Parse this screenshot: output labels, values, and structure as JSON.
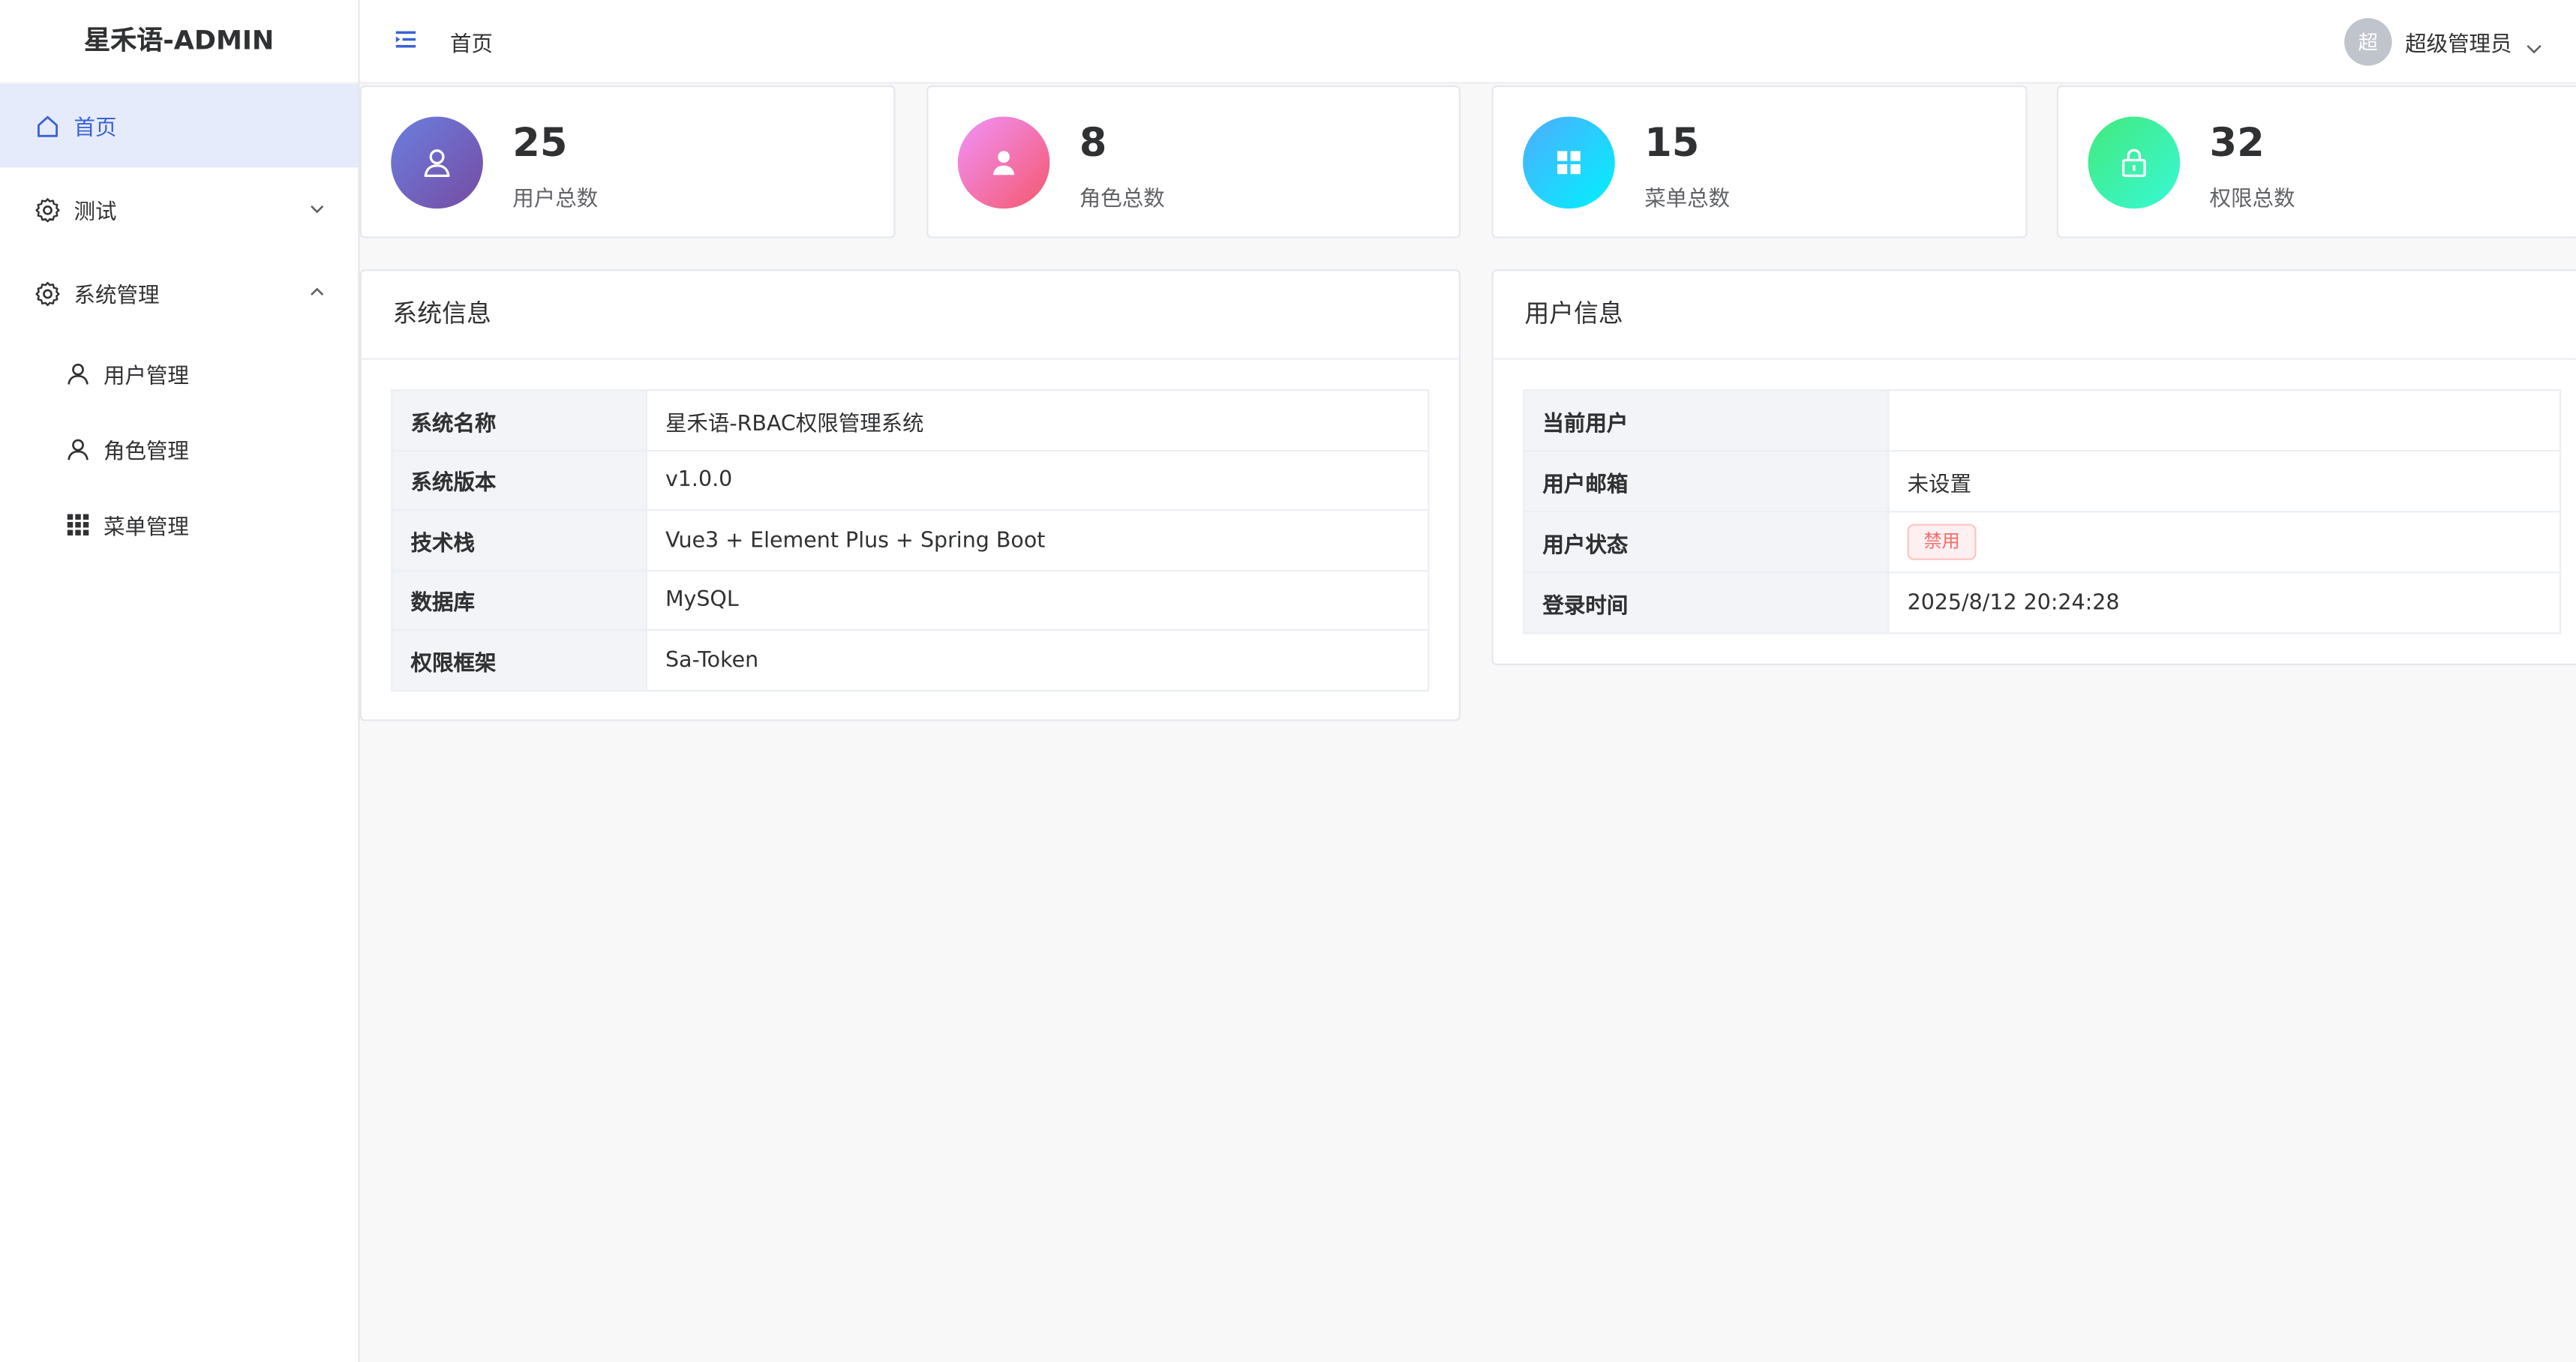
{
  "app": {
    "title": "星禾语-ADMIN"
  },
  "sidebar": {
    "home": {
      "label": "首页",
      "icon": "home-icon"
    },
    "test": {
      "label": "测试",
      "icon": "gear-icon"
    },
    "system": {
      "label": "系统管理",
      "icon": "gear-icon",
      "children": [
        {
          "label": "用户管理",
          "icon": "user-icon"
        },
        {
          "label": "角色管理",
          "icon": "user-icon"
        },
        {
          "label": "菜单管理",
          "icon": "grid-icon"
        }
      ]
    }
  },
  "header": {
    "breadcrumb": "首页",
    "user": {
      "avatar_text": "超",
      "name": "超级管理员"
    }
  },
  "stats": [
    {
      "value": "25",
      "label": "用户总数",
      "icon": "user-icon",
      "gradient": [
        "#6b7fe0",
        "#764ba2"
      ]
    },
    {
      "value": "8",
      "label": "角色总数",
      "icon": "person-icon",
      "gradient": [
        "#f093fb",
        "#f5576c"
      ]
    },
    {
      "value": "15",
      "label": "菜单总数",
      "icon": "grid-icon",
      "gradient": [
        "#4facfe",
        "#00f2fe"
      ]
    },
    {
      "value": "32",
      "label": "权限总数",
      "icon": "lock-icon",
      "gradient": [
        "#43e97b",
        "#38f9d7"
      ]
    }
  ],
  "system_info": {
    "title": "系统信息",
    "rows": [
      {
        "label": "系统名称",
        "value": "星禾语-RBAC权限管理系统"
      },
      {
        "label": "系统版本",
        "value": "v1.0.0"
      },
      {
        "label": "技术栈",
        "value": "Vue3 + Element Plus + Spring Boot"
      },
      {
        "label": "数据库",
        "value": "MySQL"
      },
      {
        "label": "权限框架",
        "value": "Sa-Token"
      }
    ]
  },
  "user_info": {
    "title": "用户信息",
    "rows": [
      {
        "label": "当前用户",
        "value": ""
      },
      {
        "label": "用户邮箱",
        "value": "未设置"
      },
      {
        "label": "用户状态",
        "value": "禁用",
        "tag": "danger"
      },
      {
        "label": "登录时间",
        "value": "2025/8/12 20:24:28"
      }
    ]
  },
  "colors": {
    "accent": "#3a62d7",
    "active_bg": "#e6ebfc",
    "danger": "#f56c6c"
  }
}
